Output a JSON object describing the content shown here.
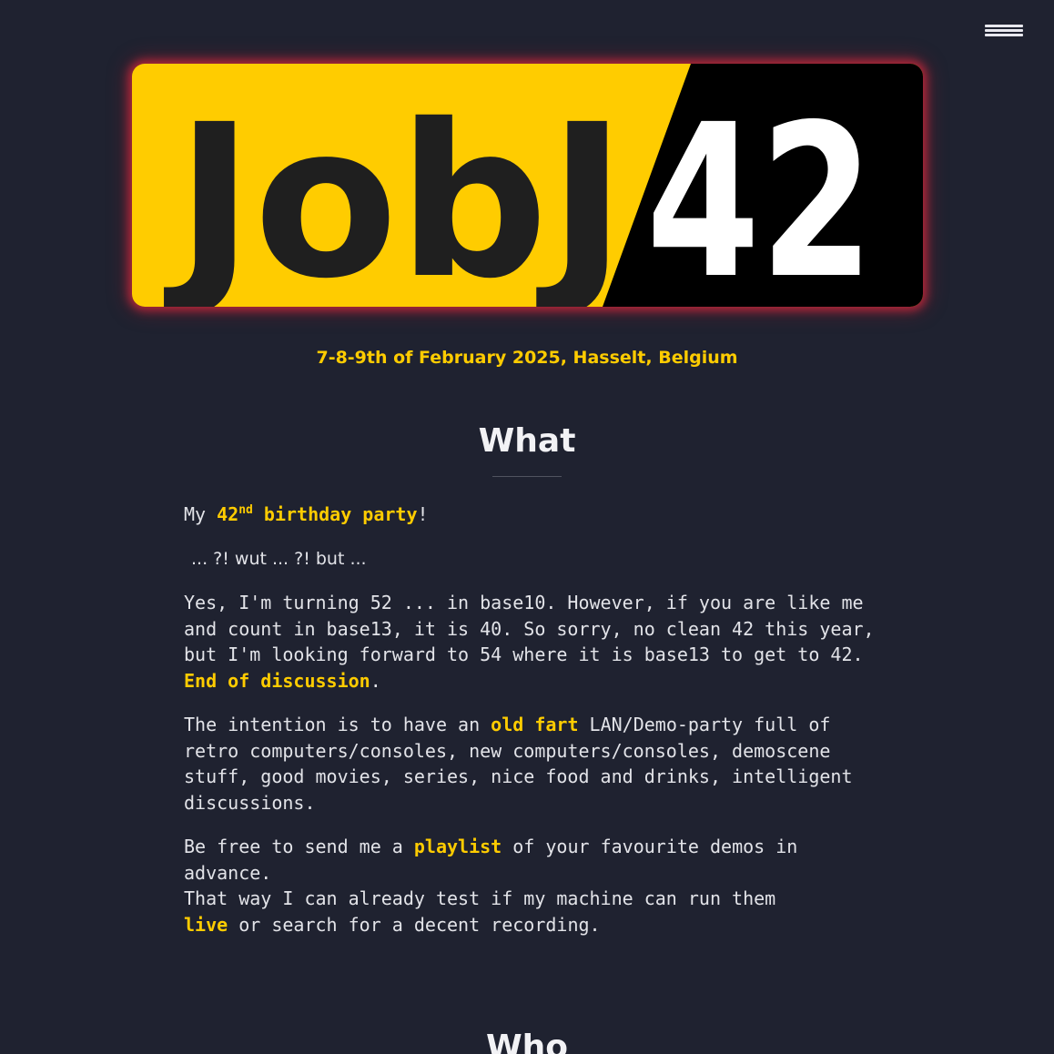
{
  "menu": {
    "icon": "hamburger-menu-icon"
  },
  "logo": {
    "word_left": "JobJ",
    "word_right": "42",
    "colors": {
      "yellow": "#ffcc00",
      "black": "#000000",
      "glow": "#d6283c"
    }
  },
  "event": {
    "dates": "7-8-9th of February 2025, Hasselt, Belgium"
  },
  "what": {
    "title": "What",
    "intro": {
      "prefix": "My ",
      "number": "42",
      "suffix": "nd",
      "highlight": "birthday party",
      "end": "!"
    },
    "question": "... ?! wut ... ?! but ...",
    "explanation": {
      "text": "Yes, I'm turning 52 ... in base10. However, if you are like me and count in base13, it is 40. So sorry, no clean 42 this year, but I'm looking forward to 54 where it is base13 to get to 42. ",
      "highlight": "End of discussion",
      "end": "."
    },
    "intention": {
      "before": "The intention is to have an ",
      "highlight": "old fart",
      "after": " LAN/Demo-party full of retro computers/consoles, new computers/consoles, demoscene stuff, good movies, series, nice food and drinks, intelligent discussions."
    },
    "playlist": {
      "before": "Be free to send me a ",
      "highlight": "playlist",
      "after": " of your favourite demos in advance.",
      "line2": "That way I can already test if my machine can run them",
      "live": "live",
      "line3": " or search for a decent recording."
    }
  },
  "who": {
    "title": "Who"
  },
  "colors": {
    "background": "#1f2230",
    "accent": "#ffcc00",
    "text": "#e2e3e8"
  }
}
